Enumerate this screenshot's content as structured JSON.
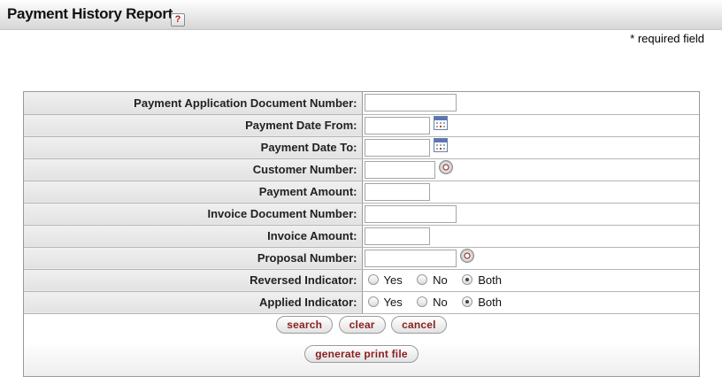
{
  "header": {
    "title": "Payment History Report",
    "help_icon": "help-icon",
    "required_note": "* required field"
  },
  "fields": [
    {
      "label": "Payment Application Document Number:",
      "type": "text",
      "value": ""
    },
    {
      "label": "Payment Date From:",
      "type": "date",
      "value": ""
    },
    {
      "label": "Payment Date To:",
      "type": "date",
      "value": ""
    },
    {
      "label": "Customer Number:",
      "type": "lookup",
      "value": ""
    },
    {
      "label": "Payment Amount:",
      "type": "text",
      "value": ""
    },
    {
      "label": "Invoice Document Number:",
      "type": "text",
      "value": ""
    },
    {
      "label": "Invoice Amount:",
      "type": "text",
      "value": ""
    },
    {
      "label": "Proposal Number:",
      "type": "lookup",
      "value": ""
    },
    {
      "label": "Reversed Indicator:",
      "type": "radio",
      "options": [
        "Yes",
        "No",
        "Both"
      ],
      "selected": "Both"
    },
    {
      "label": "Applied Indicator:",
      "type": "radio",
      "options": [
        "Yes",
        "No",
        "Both"
      ],
      "selected": "Both"
    }
  ],
  "buttons": {
    "search": "search",
    "clear": "clear",
    "cancel": "cancel",
    "generate": "generate print file"
  },
  "colors": {
    "button_text": "#8b1e1e",
    "label_background": "#e8e8e8"
  }
}
